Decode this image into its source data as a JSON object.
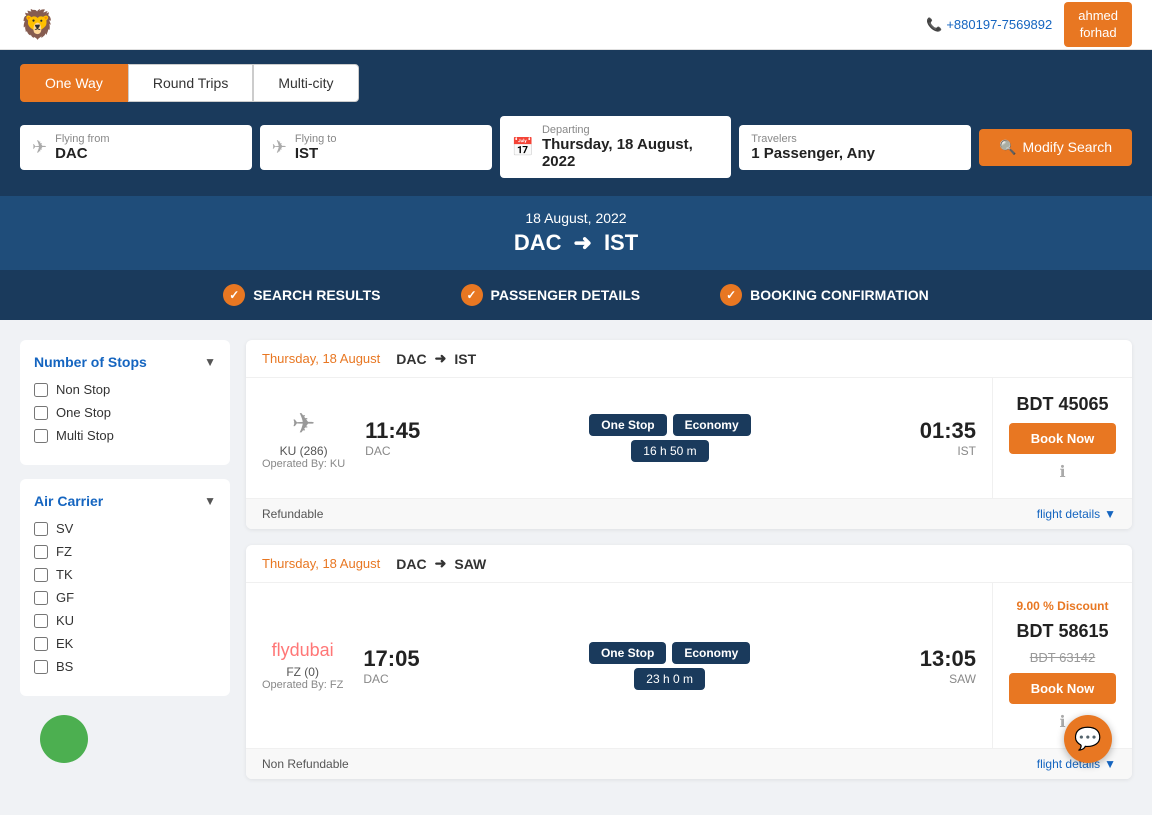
{
  "header": {
    "logo_emoji": "🦁",
    "phone": "+880197-7569892",
    "user_name": "ahmed",
    "user_sub": "forhad"
  },
  "trip_tabs": [
    {
      "label": "One Way",
      "active": true
    },
    {
      "label": "Round Trips",
      "active": false
    },
    {
      "label": "Multi-city",
      "active": false
    }
  ],
  "search": {
    "flying_from_label": "Flying from",
    "flying_from_value": "DAC",
    "flying_to_label": "Flying to",
    "flying_to_value": "IST",
    "departing_label": "Departing",
    "departing_value": "Thursday, 18 August, 2022",
    "travelers_label": "Travelers",
    "travelers_value": "1 Passenger, Any",
    "modify_btn": "Modify Search"
  },
  "route_banner": {
    "date": "18 August, 2022",
    "from": "DAC",
    "to": "IST"
  },
  "steps": [
    {
      "label": "SEARCH RESULTS"
    },
    {
      "label": "PASSENGER DETAILS"
    },
    {
      "label": "BOOKING CONFIRMATION"
    }
  ],
  "sidebar": {
    "stops_title": "Number of Stops",
    "stops_options": [
      {
        "label": "Non Stop"
      },
      {
        "label": "One Stop"
      },
      {
        "label": "Multi Stop"
      }
    ],
    "carrier_title": "Air Carrier",
    "carrier_options": [
      {
        "label": "SV"
      },
      {
        "label": "FZ"
      },
      {
        "label": "TK"
      },
      {
        "label": "GF"
      },
      {
        "label": "KU"
      },
      {
        "label": "EK"
      },
      {
        "label": "BS"
      }
    ]
  },
  "results": [
    {
      "date": "Thursday, 18 August",
      "from": "DAC",
      "to": "IST",
      "depart_time": "11:45",
      "depart_airport": "DAC",
      "airline_code": "KU (286)",
      "operated_by": "Operated By: KU",
      "stop_label": "One Stop",
      "class_label": "Economy",
      "duration": "16 h 50 m",
      "arrive_time": "01:35",
      "arrive_airport": "IST",
      "price": "BDT 45065",
      "price_old": "",
      "discount": "",
      "book_btn": "Book Now",
      "refundable": "Refundable",
      "flight_details": "flight details"
    },
    {
      "date": "Thursday, 18 August",
      "from": "DAC",
      "to": "SAW",
      "depart_time": "17:05",
      "depart_airport": "DAC",
      "airline_code": "FZ (0)",
      "operated_by": "Operated By: FZ",
      "stop_label": "One Stop",
      "class_label": "Economy",
      "duration": "23 h 0 m",
      "arrive_time": "13:05",
      "arrive_airport": "SAW",
      "price": "BDT 58615",
      "price_old": "BDT 63142",
      "discount": "9.00 % Discount",
      "book_btn": "Book Now",
      "refundable": "Non Refundable",
      "flight_details": "flight details"
    }
  ]
}
